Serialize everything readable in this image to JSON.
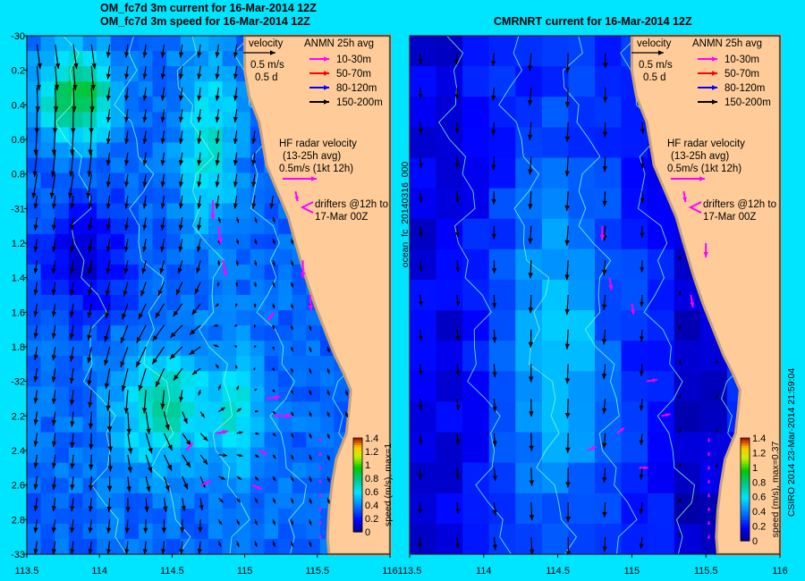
{
  "titles": {
    "left_line1": "OM_fc7d 3m current for 16-Mar-2014 12Z",
    "left_line2": "OM_fc7d 3m speed for 16-Mar-2014 12Z",
    "right_line1": "CMRNRT current for 16-Mar-2014 12Z"
  },
  "axes": {
    "x_ticks": [
      "113.5",
      "114",
      "114.5",
      "115",
      "115.5",
      "116"
    ],
    "y_ticks": [
      "-30",
      "0.2",
      "0.4",
      "0.6",
      "0.8",
      "-31",
      "1.2",
      "1.4",
      "1.6",
      "1.8",
      "-32",
      "2.2",
      "2.4",
      "2.6",
      "2.8",
      "-33"
    ],
    "lon_range": [
      113.5,
      116
    ],
    "lat_range": [
      -30,
      -33
    ]
  },
  "legend": {
    "velocity_label": "velocity",
    "velocity_scale": "0.5 m/s",
    "velocity_time": "0.5 d",
    "anmn_title": "ANMN 25h avg",
    "depths": [
      {
        "label": "10-30m",
        "color": "#ff00ff"
      },
      {
        "label": "50-70m",
        "color": "#ff0000"
      },
      {
        "label": "80-120m",
        "color": "#0000ff"
      },
      {
        "label": "150-200m",
        "color": "#000000"
      }
    ],
    "hf_line1": "HF radar velocity",
    "hf_line2": "(13-25h avg)",
    "hf_line3": "0.5m/s (1kt 12h)",
    "drifter_line1": "drifters @12h to",
    "drifter_line2": "17-Mar 00Z"
  },
  "colorbar": {
    "ticks": [
      "1.4",
      "1.2",
      "1",
      "0.8",
      "0.6",
      "0.4",
      "0.2",
      "0"
    ],
    "left_label": "speed (m/s), max=1",
    "right_label": "speed (m/s), max=0.37"
  },
  "side_labels": {
    "run_id": "ocean_fc_20140316_000",
    "credit": "CSIRO 2014   23-Mar-2014 21:59:04"
  },
  "colors": {
    "background": "#00e5ff",
    "land": "#ffcc99",
    "coast": "#c8a078",
    "hf_arrow": "#ff00ff",
    "contour": "#7fffd4"
  }
}
